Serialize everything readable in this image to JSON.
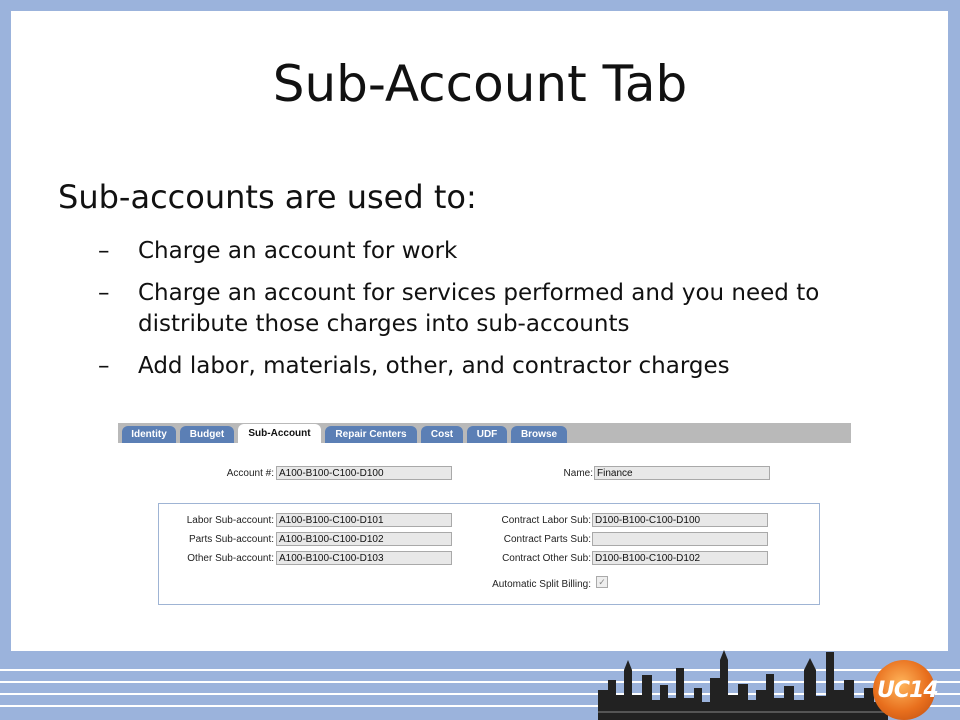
{
  "slide": {
    "title": "Sub-Account Tab",
    "lead": "Sub-accounts are used to:",
    "bullets": [
      "Charge an account for work",
      "Charge an account for services performed and you need to distribute those charges into sub-accounts",
      "Add labor, materials, other, and contractor charges"
    ],
    "bullet_marker": "–"
  },
  "screenshot": {
    "tabs": [
      "Identity",
      "Budget",
      "Sub-Account",
      "Repair Centers",
      "Cost",
      "UDF",
      "Browse"
    ],
    "active_tab": "Sub-Account",
    "account_label": "Account #:",
    "account_value": "A100-B100-C100-D100",
    "name_label": "Name:",
    "name_value": "Finance",
    "labor_sub_label": "Labor Sub-account:",
    "labor_sub_value": "A100-B100-C100-D101",
    "parts_sub_label": "Parts Sub-account:",
    "parts_sub_value": "A100-B100-C100-D102",
    "other_sub_label": "Other Sub-account:",
    "other_sub_value": "A100-B100-C100-D103",
    "contract_labor_label": "Contract Labor Sub:",
    "contract_labor_value": "D100-B100-C100-D100",
    "contract_parts_label": "Contract Parts Sub:",
    "contract_parts_value": "",
    "contract_other_label": "Contract Other Sub:",
    "contract_other_value": "D100-B100-C100-D102",
    "auto_split_label": "Automatic Split Billing:",
    "auto_split_checked": true
  },
  "footer": {
    "logo_text": "UC14"
  },
  "colors": {
    "background": "#9bb3dc",
    "tab": "#5b7fb5",
    "logo": "#e86f1d"
  }
}
